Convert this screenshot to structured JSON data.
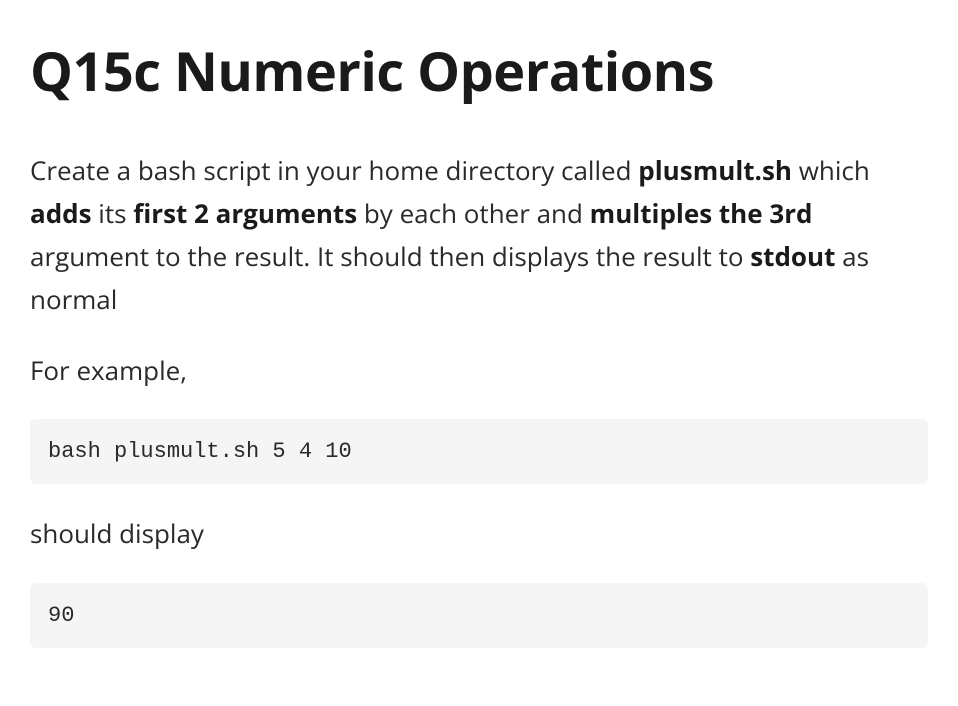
{
  "heading": "Q15c Numeric Operations",
  "paragraph1": {
    "t1": "Create a bash script in your home directory called ",
    "b1": "plusmult.sh",
    "t2": " which ",
    "b2": "adds",
    "t3": " its ",
    "b3": "first 2 arguments",
    "t4": " by each other and ",
    "b4": "multiples the 3rd",
    "t5": " argument to the result. It should then displays the result to ",
    "b5": "stdout",
    "t6": " as normal"
  },
  "paragraph2": "For example,",
  "code1": "bash plusmult.sh 5 4 10",
  "paragraph3": "should display",
  "code2": "90"
}
